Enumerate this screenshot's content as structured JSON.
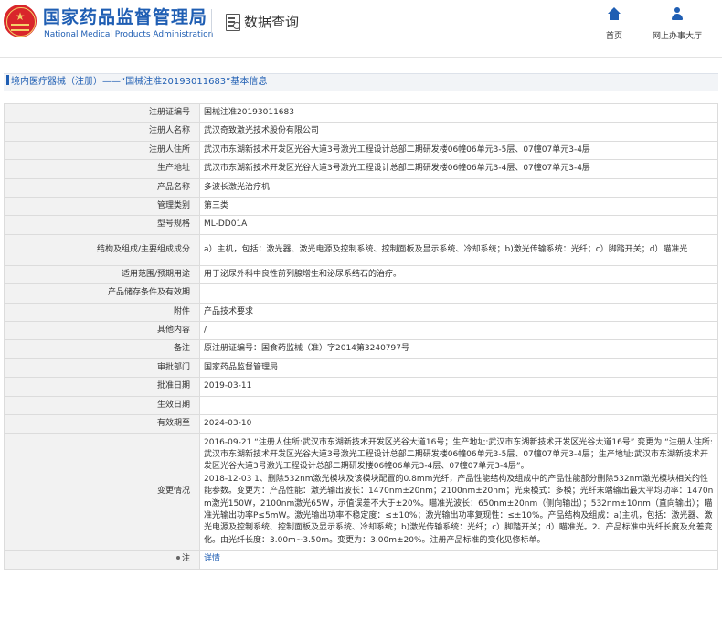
{
  "header": {
    "org_name_cn": "国家药品监督管理局",
    "org_name_en": "National Medical Products Administration",
    "query_title": "数据查询",
    "nav": [
      {
        "label": "首页",
        "icon": "home-icon"
      },
      {
        "label": "网上办事大厅",
        "icon": "user-icon"
      }
    ]
  },
  "breadcrumb": "境内医疗器械（注册）——“国械注准20193011683”基本信息",
  "colors": {
    "brand_blue": "#1f5eb3",
    "logo_red": "#d9252b",
    "label_bg": "#f2f2f2"
  },
  "rows": [
    {
      "label": "注册证编号",
      "value": "国械注准20193011683"
    },
    {
      "label": "注册人名称",
      "value": "武汉奇致激光技术股份有限公司"
    },
    {
      "label": "注册人住所",
      "value": "武汉市东湖新技术开发区光谷大道3号激光工程设计总部二期研发楼06幢06单元3-5层、07幢07单元3-4层"
    },
    {
      "label": "生产地址",
      "value": "武汉市东湖新技术开发区光谷大道3号激光工程设计总部二期研发楼06幢06单元3-4层、07幢07单元3-4层"
    },
    {
      "label": "产品名称",
      "value": "多波长激光治疗机"
    },
    {
      "label": "管理类别",
      "value": "第三类"
    },
    {
      "label": "型号规格",
      "value": "ML-DD01A"
    },
    {
      "label": "结构及组成/主要组成成分",
      "value": "a）主机，包括：激光器、激光电源及控制系统、控制面板及显示系统、冷却系统；b)激光传输系统：光纤；c）脚踏开关；d）瞄准光"
    },
    {
      "label": "适用范围/预期用途",
      "value": "用于泌尿外科中良性前列腺增生和泌尿系结石的治疗。"
    },
    {
      "label": "产品储存条件及有效期",
      "value": ""
    },
    {
      "label": "附件",
      "value": "产品技术要求"
    },
    {
      "label": "其他内容",
      "value": "/"
    },
    {
      "label": "备注",
      "value": "原注册证编号：国食药监械（准）字2014第3240797号"
    },
    {
      "label": "审批部门",
      "value": "国家药品监督管理局"
    },
    {
      "label": "批准日期",
      "value": "2019-03-11"
    },
    {
      "label": "生效日期",
      "value": ""
    },
    {
      "label": "有效期至",
      "value": "2024-03-10"
    },
    {
      "label": "变更情况",
      "value": "2016-09-21 “注册人住所:武汉市东湖新技术开发区光谷大道16号；生产地址:武汉市东湖新技术开发区光谷大道16号” 变更为 “注册人住所:武汉市东湖新技术开发区光谷大道3号激光工程设计总部二期研发楼06幢06单元3-5层、07幢07单元3-4层；生产地址:武汉市东湖新技术开发区光谷大道3号激光工程设计总部二期研发楼06幢06单元3-4层、07幢07单元3-4层”。\n2018-12-03 1、删除532nm激光模块及该模块配置的0.8mm光纤，产品性能结构及组成中的产品性能部分删除532nm激光模块相关的性能参数。变更为：产品性能：激光输出波长：1470nm±20nm；2100nm±20nm；光束模式：多模；光纤末端输出最大平均功率：1470nm激光150W，2100nm激光65W，示值误差不大于±20%。瞄准光波长：650nm±20nm（侧向输出）；532nm±10nm（直向输出）；瞄准光输出功率P≤5mW。激光输出功率不稳定度：≤±10%；激光输出功率复现性：≤±10%。产品结构及组成：a)主机，包括：激光器、激光电源及控制系统、控制面板及显示系统、冷却系统；b)激光传输系统：光纤；c）脚踏开关；d）瞄准光。2、产品标准中光纤长度及允差变化。由光纤长度：3.00m~3.50m。变更为：3.00m±20%。注册产品标准的变化见修标单。"
    },
    {
      "label": "注",
      "value": "详情"
    }
  ]
}
